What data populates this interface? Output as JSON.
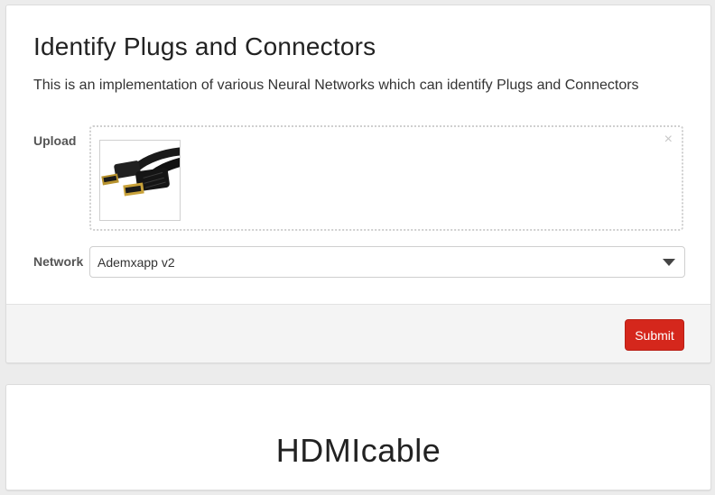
{
  "form": {
    "title": "Identify Plugs and Connectors",
    "subtitle": "This is an implementation of various Neural Networks which can identify Plugs and Connectors",
    "upload_label": "Upload",
    "remove_glyph": "×",
    "network_label": "Network",
    "network_selected": "Ademxapp v2",
    "submit_label": "Submit"
  },
  "result": {
    "prediction": "HDMIcable"
  },
  "icons": {
    "remove": "close-icon",
    "dropdown": "chevron-down-icon"
  },
  "colors": {
    "submit_bg": "#d5271c",
    "page_bg": "#ececec"
  }
}
